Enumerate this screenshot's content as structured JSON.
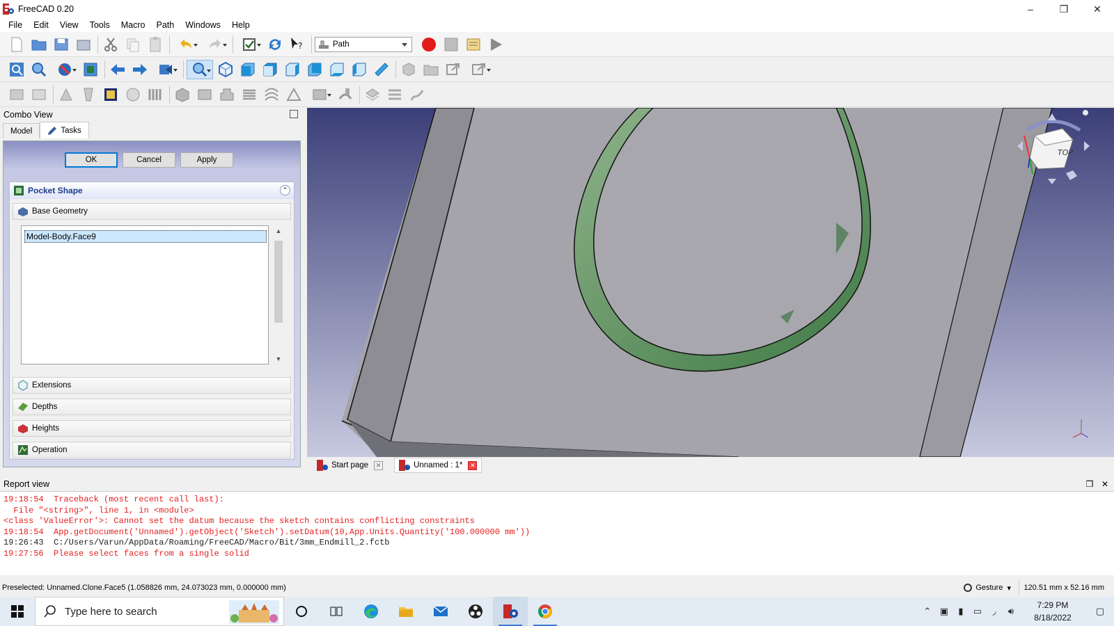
{
  "window": {
    "title": "FreeCAD 0.20"
  },
  "menu": [
    "File",
    "Edit",
    "View",
    "Tools",
    "Macro",
    "Path",
    "Windows",
    "Help"
  ],
  "workbench": {
    "selected": "Path"
  },
  "combo_view": {
    "title": "Combo View",
    "tabs": [
      {
        "label": "Model"
      },
      {
        "label": "Tasks"
      }
    ],
    "buttons": {
      "ok": "OK",
      "cancel": "Cancel",
      "apply": "Apply"
    },
    "panel_title": "Pocket Shape",
    "sections": {
      "base_geometry": "Base Geometry",
      "extensions": "Extensions",
      "depths": "Depths",
      "heights": "Heights",
      "operation": "Operation"
    },
    "geometry_items": [
      "Model-Body.Face9"
    ]
  },
  "doc_tabs": [
    {
      "label": "Start page"
    },
    {
      "label": "Unnamed : 1*"
    }
  ],
  "report_view": {
    "title": "Report view",
    "lines": [
      {
        "text": "19:18:54  Traceback (most recent call last):",
        "kind": "err"
      },
      {
        "text": "  File \"<string>\", line 1, in <module>",
        "kind": "err"
      },
      {
        "text": "<class 'ValueError'>: Cannot set the datum because the sketch contains conflicting constraints",
        "kind": "err"
      },
      {
        "text": "19:18:54  App.getDocument('Unnamed').getObject('Sketch').setDatum(10,App.Units.Quantity('100.000000 mm'))",
        "kind": "err"
      },
      {
        "text": "19:26:43  C:/Users/Varun/AppData/Roaming/FreeCAD/Macro/Bit/3mm_Endmill_2.fctb",
        "kind": "msg"
      },
      {
        "text": "19:27:56  Please select faces from a single solid",
        "kind": "err"
      }
    ]
  },
  "status": {
    "preselected": "Preselected: Unnamed.Clone.Face5 (1.058826 mm, 24.073023 mm, 0.000000 mm)",
    "nav_style": "Gesture",
    "dimensions": "120.51 mm x 52.16 mm"
  },
  "taskbar": {
    "search_placeholder": "Type here to search",
    "time": "7:29 PM",
    "date": "8/18/2022"
  },
  "colors": {
    "view_bg_top": "#3b3f78",
    "view_bg_bottom": "#c7c9df",
    "error_text": "#e62020",
    "accent": "#1b3c8a"
  }
}
